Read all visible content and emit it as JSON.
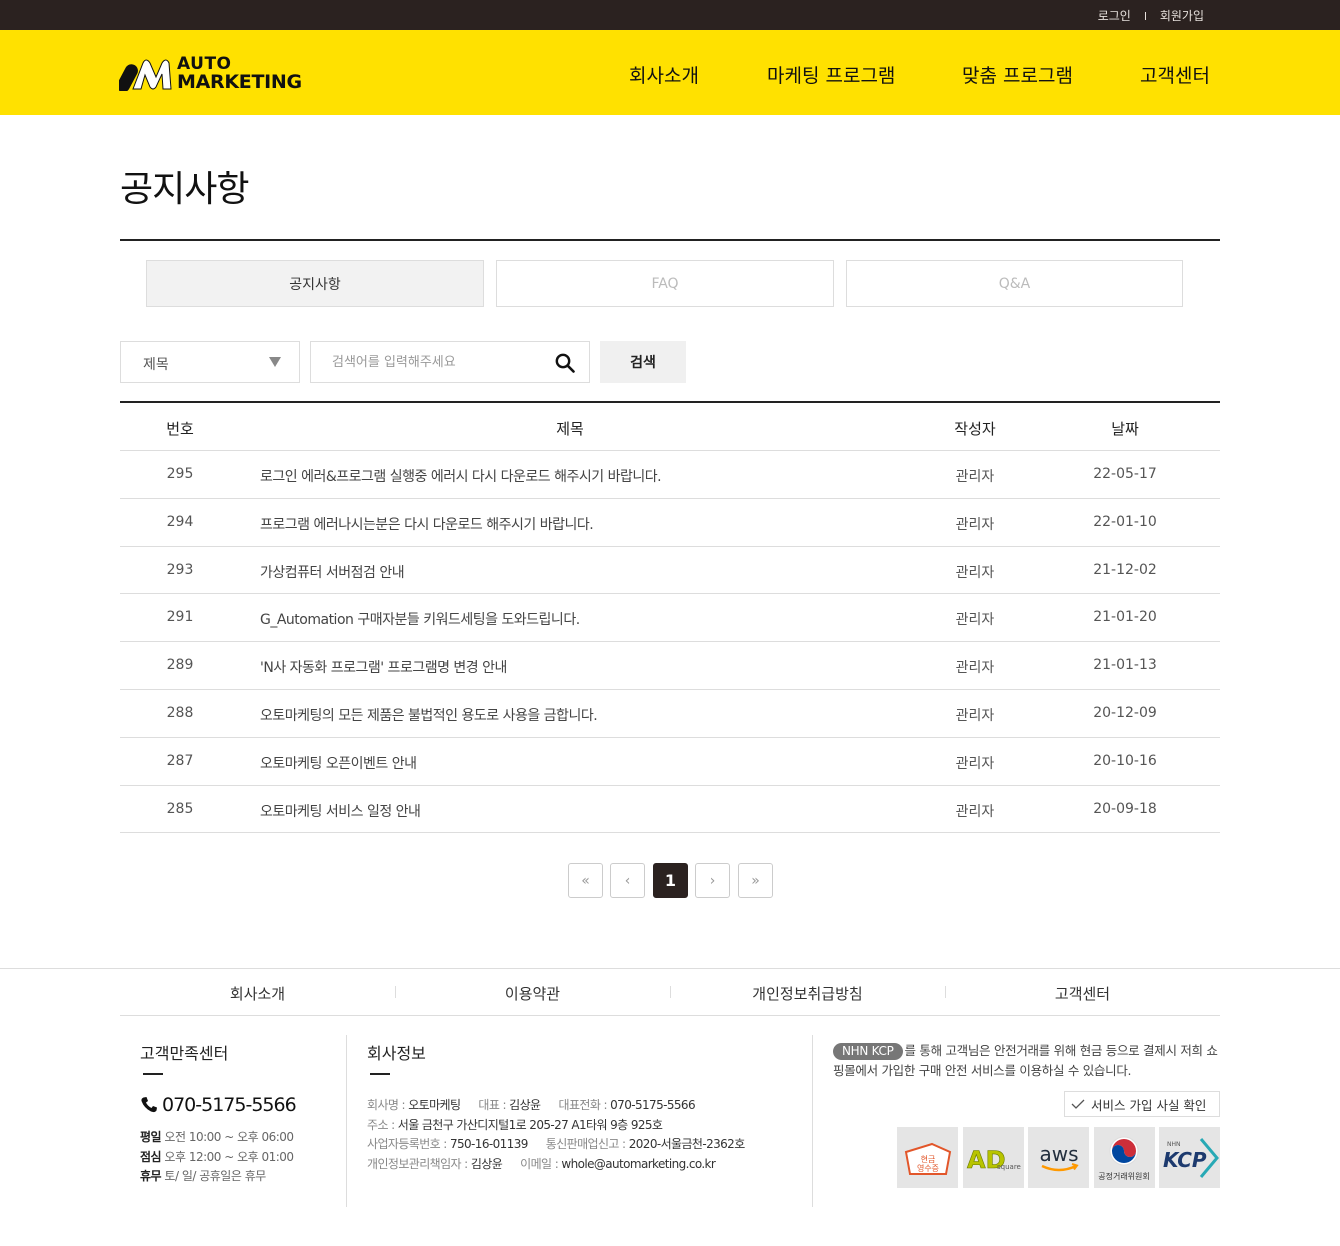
{
  "topbar": {
    "login": "로그인",
    "signup": "회원가입"
  },
  "brand": {
    "line1": "AUTO",
    "line2": "MARKETING",
    "accent": "#ffe100"
  },
  "nav": [
    {
      "label": "회사소개"
    },
    {
      "label": "마케팅 프로그램"
    },
    {
      "label": "맞춤 프로그램"
    },
    {
      "label": "고객센터"
    }
  ],
  "page": {
    "title": "공지사항"
  },
  "tabs": [
    {
      "label": "공지사항",
      "active": true
    },
    {
      "label": "FAQ",
      "active": false
    },
    {
      "label": "Q&A",
      "active": false
    }
  ],
  "search": {
    "field_value": "제목",
    "placeholder": "검색어를 입력해주세요",
    "button": "검색"
  },
  "table": {
    "headers": {
      "no": "번호",
      "title": "제목",
      "author": "작성자",
      "date": "날짜"
    },
    "rows": [
      {
        "no": "295",
        "title": "로그인 에러&프로그램 실행중 에러시 다시 다운로드 해주시기 바랍니다.",
        "author": "관리자",
        "date": "22-05-17"
      },
      {
        "no": "294",
        "title": "프로그램 에러나시는분은 다시 다운로드 해주시기 바랍니다.",
        "author": "관리자",
        "date": "22-01-10"
      },
      {
        "no": "293",
        "title": "가상컴퓨터 서버점검 안내",
        "author": "관리자",
        "date": "21-12-02"
      },
      {
        "no": "291",
        "title": "G_Automation 구매자분들 키워드세팅을 도와드립니다.",
        "author": "관리자",
        "date": "21-01-20"
      },
      {
        "no": "289",
        "title": "'N사 자동화 프로그램' 프로그램명 변경 안내",
        "author": "관리자",
        "date": "21-01-13"
      },
      {
        "no": "288",
        "title": "오토마케팅의 모든 제품은 불법적인 용도로 사용을 금합니다.",
        "author": "관리자",
        "date": "20-12-09"
      },
      {
        "no": "287",
        "title": "오토마케팅 오픈이벤트 안내",
        "author": "관리자",
        "date": "20-10-16"
      },
      {
        "no": "285",
        "title": "오토마케팅 서비스 일정 안내",
        "author": "관리자",
        "date": "20-09-18"
      }
    ]
  },
  "pagination": {
    "first": "«",
    "prev": "‹",
    "current": "1",
    "next": "›",
    "last": "»"
  },
  "footer": {
    "nav": [
      "회사소개",
      "이용약관",
      "개인정보취급방침",
      "고객센터"
    ],
    "cs": {
      "title": "고객만족센터",
      "phone": "070-5175-5566",
      "hours": [
        {
          "label": "평일",
          "value": "오전 10:00 ~ 오후 06:00"
        },
        {
          "label": "점심",
          "value": "오후 12:00 ~ 오후 01:00"
        },
        {
          "label": "휴무",
          "value": "토/ 일/ 공휴일은 휴무"
        }
      ]
    },
    "company": {
      "title": "회사정보",
      "name_label": "회사명 : ",
      "name": "오토마케팅",
      "ceo_label": "대표 : ",
      "ceo": "김상윤",
      "tel_label": "대표전화 : ",
      "tel": "070-5175-5566",
      "addr_label": "주소 : ",
      "addr": "서울 금천구 가산디지털1로 205-27 A1타워 9층 925호",
      "bizno_label": "사업자등록번호 : ",
      "bizno": "750-16-01139",
      "mail_order_label": "통신판매업신고 : ",
      "mail_order": "2020-서울금천-2362호",
      "privacy_label": "개인정보관리책임자 : ",
      "privacy": "김상윤",
      "email_label": "이메일 : ",
      "email": "whole@automarketing.co.kr"
    },
    "kcp": {
      "badge": "NHN KCP",
      "text": "를 통해 고객님은 안전거래를 위해 현금 등으로 결제시 저희 쇼핑몰에서 가입한 구매 안전 서비스를 이용하실 수 있습니다.",
      "verify": "서비스 가입 사실 확인"
    },
    "logos": [
      {
        "name": "cash-receipt-logo",
        "label": "현금영수증"
      },
      {
        "name": "adsquare-logo",
        "label": "AD",
        "sub": "square"
      },
      {
        "name": "aws-logo",
        "label": "aws"
      },
      {
        "name": "ftc-logo",
        "label": "공정거래위원회"
      },
      {
        "name": "kcp-logo",
        "label": "KCP",
        "sub": "NHN"
      }
    ]
  }
}
